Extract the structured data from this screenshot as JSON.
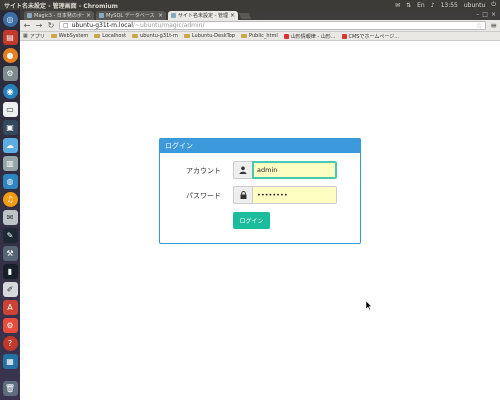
{
  "panel_top": {
    "window_title": "サイト名未設定 - 管理画面 - Chromium",
    "time": "13:55",
    "user": "ubuntu"
  },
  "tabs": [
    {
      "label": "Magic3 - 日本発のボータル",
      "active": false
    },
    {
      "label": "MySQL データベース サー",
      "active": false
    },
    {
      "label": "サイト名未設定 - 管理画面",
      "active": true
    }
  ],
  "omnibox": {
    "host": "ubuntu-g31t-m.local",
    "path": "/~ubuntu/magic/admin/"
  },
  "bookmarks": [
    {
      "label": "アプリ",
      "type": "apps"
    },
    {
      "label": "WebSystem",
      "type": "folder"
    },
    {
      "label": "Localhost",
      "type": "folder"
    },
    {
      "label": "ubuntu-g31t-m",
      "type": "folder"
    },
    {
      "label": "Lubuntu-DeskTop",
      "type": "folder"
    },
    {
      "label": "Public_html",
      "type": "folder"
    },
    {
      "label": "山形情報律 - 山形...",
      "type": "page"
    },
    {
      "label": "CMSでホームページ...",
      "type": "page"
    }
  ],
  "login": {
    "header": "ログイン",
    "account_label": "アカウント",
    "account_value": "admin",
    "password_label": "パスワード",
    "password_value": "••••••••",
    "button_label": "ログイン"
  },
  "colors": {
    "panel_header": "#3c99dc",
    "button": "#1abc9c",
    "input_bg": "#fdfec2"
  }
}
